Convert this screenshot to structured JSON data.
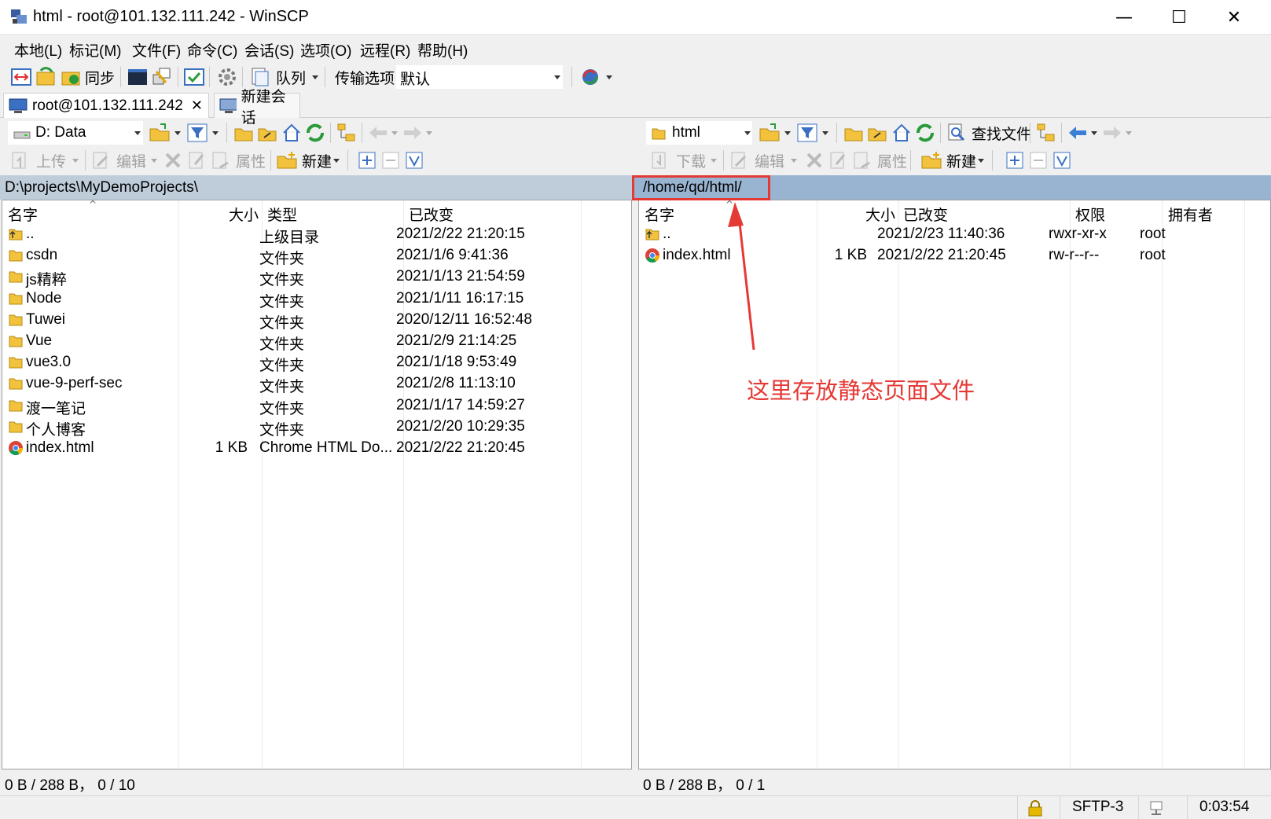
{
  "window": {
    "title": "html - root@101.132.111.242 - WinSCP",
    "minimize": "—",
    "maximize": "☐",
    "close": "✕"
  },
  "menu": [
    "本地(L)",
    "标记(M)",
    "文件(F)",
    "命令(C)",
    "会话(S)",
    "选项(O)",
    "远程(R)",
    "帮助(H)"
  ],
  "toolbar": {
    "sync_label": "同步",
    "queue_label": "队列",
    "transfer_label": "传输选项",
    "transfer_value": "默认"
  },
  "tabs": [
    {
      "label": "root@101.132.111.242"
    },
    {
      "label": "新建会话"
    }
  ],
  "left": {
    "drive": "D: Data",
    "actions": {
      "upload": "上传",
      "edit": "编辑",
      "props": "属性",
      "new": "新建"
    },
    "path": "D:\\projects\\MyDemoProjects\\",
    "columns": [
      "名字",
      "大小",
      "类型",
      "已改变"
    ],
    "rows": [
      {
        "name": "..",
        "size": "",
        "type": "上级目录",
        "changed": "2021/2/22  21:20:15",
        "icon": "parent-dir"
      },
      {
        "name": "csdn",
        "size": "",
        "type": "文件夹",
        "changed": "2021/1/6  9:41:36",
        "icon": "folder"
      },
      {
        "name": "js精粹",
        "size": "",
        "type": "文件夹",
        "changed": "2021/1/13  21:54:59",
        "icon": "folder"
      },
      {
        "name": "Node",
        "size": "",
        "type": "文件夹",
        "changed": "2021/1/11  16:17:15",
        "icon": "folder"
      },
      {
        "name": "Tuwei",
        "size": "",
        "type": "文件夹",
        "changed": "2020/12/11  16:52:48",
        "icon": "folder"
      },
      {
        "name": "Vue",
        "size": "",
        "type": "文件夹",
        "changed": "2021/2/9  21:14:25",
        "icon": "folder"
      },
      {
        "name": "vue3.0",
        "size": "",
        "type": "文件夹",
        "changed": "2021/1/18  9:53:49",
        "icon": "folder"
      },
      {
        "name": "vue-9-perf-sec",
        "size": "",
        "type": "文件夹",
        "changed": "2021/2/8  11:13:10",
        "icon": "folder"
      },
      {
        "name": "渡一笔记",
        "size": "",
        "type": "文件夹",
        "changed": "2021/1/17  14:59:27",
        "icon": "folder"
      },
      {
        "name": "个人博客",
        "size": "",
        "type": "文件夹",
        "changed": "2021/2/20  10:29:35",
        "icon": "folder"
      },
      {
        "name": "index.html",
        "size": "1 KB",
        "type": "Chrome HTML Do...",
        "changed": "2021/2/22  21:20:45",
        "icon": "chrome"
      }
    ],
    "status": "0 B / 288 B，  0 / 10"
  },
  "right": {
    "dir": "html",
    "find_label": "查找文件",
    "actions": {
      "download": "下载",
      "edit": "编辑",
      "props": "属性",
      "new": "新建"
    },
    "path": "/home/qd/html/",
    "columns": [
      "名字",
      "大小",
      "已改变",
      "权限",
      "拥有者"
    ],
    "rows": [
      {
        "name": "..",
        "size": "",
        "changed": "2021/2/23 11:40:36",
        "rights": "rwxr-xr-x",
        "owner": "root",
        "icon": "parent-dir"
      },
      {
        "name": "index.html",
        "size": "1 KB",
        "changed": "2021/2/22 21:20:45",
        "rights": "rw-r--r--",
        "owner": "root",
        "icon": "chrome"
      }
    ],
    "status": "0 B / 288 B，  0 / 1"
  },
  "statusbar": {
    "protocol": "SFTP-3",
    "time": "0:03:54"
  },
  "annotation": {
    "text": "这里存放静态页面文件",
    "color": "#e53935"
  }
}
